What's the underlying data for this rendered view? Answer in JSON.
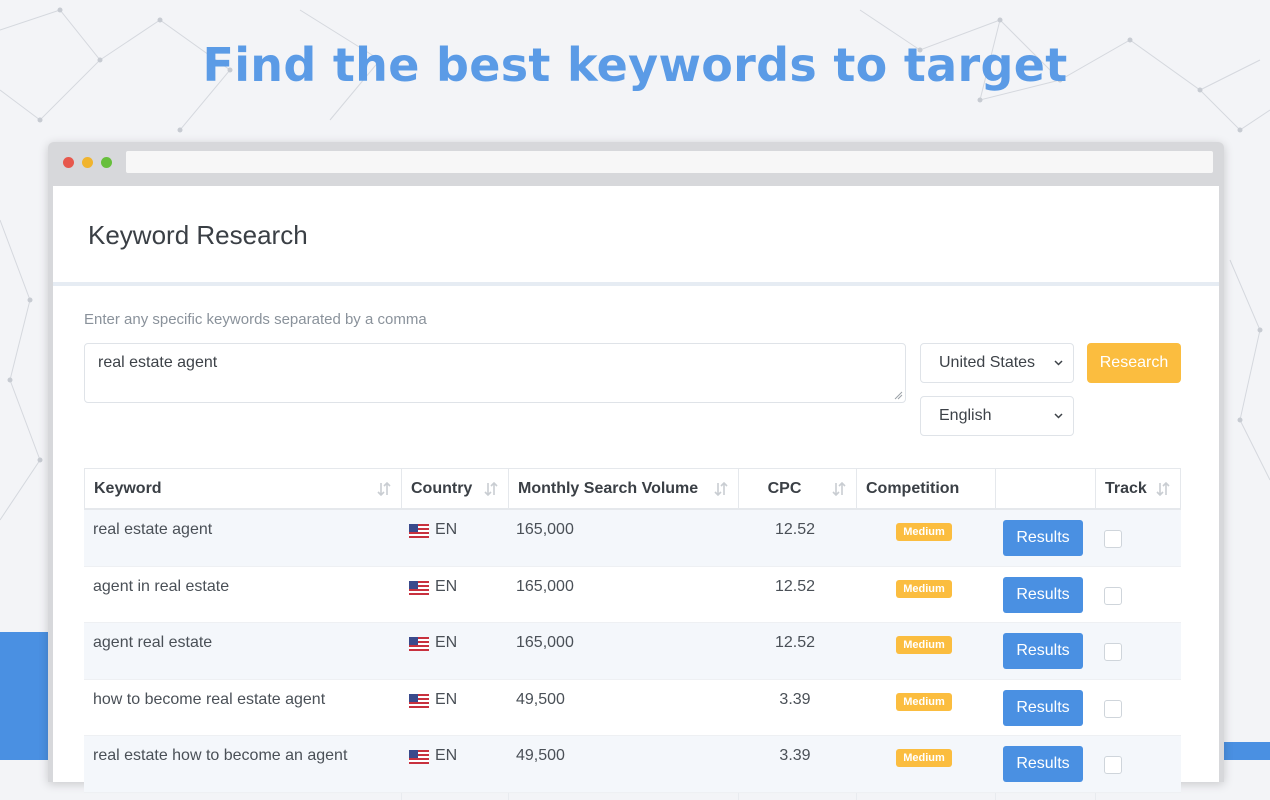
{
  "hero": {
    "title": "Find the best keywords to target"
  },
  "window": {
    "url": ""
  },
  "page": {
    "title": "Keyword Research"
  },
  "form": {
    "hint": "Enter any specific keywords separated by a comma",
    "keywords_value": "real estate agent",
    "country": "United States",
    "language": "English",
    "research_label": "Research"
  },
  "table": {
    "columns": [
      "Keyword",
      "Country",
      "Monthly Search Volume",
      "CPC",
      "Competition",
      "",
      "Track"
    ],
    "rows": [
      {
        "keyword": "real estate agent",
        "lang": "EN",
        "volume": "165,000",
        "cpc": "12.52",
        "competition": "Medium",
        "action": "Results"
      },
      {
        "keyword": "agent in real estate",
        "lang": "EN",
        "volume": "165,000",
        "cpc": "12.52",
        "competition": "Medium",
        "action": "Results"
      },
      {
        "keyword": "agent real estate",
        "lang": "EN",
        "volume": "165,000",
        "cpc": "12.52",
        "competition": "Medium",
        "action": "Results"
      },
      {
        "keyword": "how to become real estate agent",
        "lang": "EN",
        "volume": "49,500",
        "cpc": "3.39",
        "competition": "Medium",
        "action": "Results"
      },
      {
        "keyword": "real estate how to become an agent",
        "lang": "EN",
        "volume": "49,500",
        "cpc": "3.39",
        "competition": "Medium",
        "action": "Results"
      }
    ]
  },
  "colors": {
    "accent_blue": "#4a90e2",
    "accent_orange": "#fbbd3f",
    "title_blue": "#5b9be6"
  }
}
